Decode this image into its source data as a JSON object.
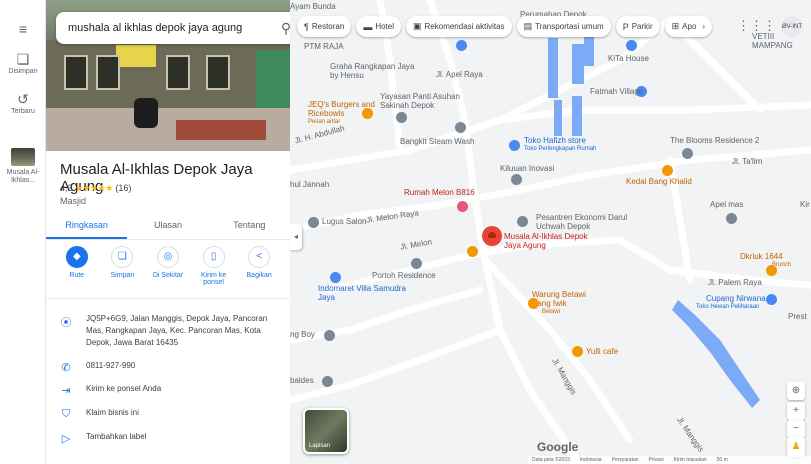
{
  "rail": {
    "menu_icon": "menu-icon",
    "saved_label": "Disimpan",
    "recent_label": "Terbaru",
    "recent_place_label": "Musala Al-Ikhlas..."
  },
  "search": {
    "query": "mushala al ikhlas depok jaya agung"
  },
  "place": {
    "title": "Musala Al-Ikhlas Depok Jaya Agung",
    "rating": "4,3",
    "stars": "★★★★★",
    "reviews": "(16)",
    "category": "Masjid"
  },
  "tabs": [
    {
      "label": "Ringkasan"
    },
    {
      "label": "Ulasan"
    },
    {
      "label": "Tentang"
    }
  ],
  "actions": [
    {
      "label": "Rute",
      "glyph": "◆"
    },
    {
      "label": "Simpan",
      "glyph": "❏"
    },
    {
      "label": "Di Sekitar",
      "glyph": "◎"
    },
    {
      "label": "Kirim ke ponsel",
      "glyph": "▯"
    },
    {
      "label": "Bagikan",
      "glyph": "<"
    }
  ],
  "info": {
    "address": "JQ5P+6G9, Jalan Manggis, Depok Jaya, Pancoran Mas, Rangkapan Jaya, Kec. Pancoran Mas, Kota Depok, Jawa Barat 16435",
    "phone": "0811-927-990",
    "send": "Kirim ke ponsel Anda",
    "claim": "Klaim bisnis ini",
    "label": "Tambahkan label"
  },
  "chips": [
    {
      "glyph": "¶",
      "label": "Restoran"
    },
    {
      "glyph": "▬",
      "label": "Hotel"
    },
    {
      "glyph": "▣",
      "label": "Rekomendasi aktivitas"
    },
    {
      "glyph": "▤",
      "label": "Transportasi umum"
    },
    {
      "glyph": "P",
      "label": "Parkir"
    },
    {
      "glyph": "⊞",
      "label": "Apo"
    }
  ],
  "map": {
    "account": "ØV-INT",
    "layers_label": "Lapisan",
    "google": "Google",
    "footer": [
      "Data peta ©2023",
      "Indonesia",
      "Persyaratan",
      "Privasi",
      "Kirim masukan",
      "50 m"
    ],
    "labels": {
      "ayam_bunda": "Ayam Bunda",
      "perumahan_depok": "Perumahan Depok",
      "ptm_raja": "PTM RAJA",
      "kita_house": "KiTa House",
      "vetamampang": "VETIII MAMPANG",
      "graha": "Graha Rangkapan Jaya by Hensu",
      "apel_raya": "Jl. Apel Raya",
      "fatmah": "Fatmah Village",
      "jeqs": "JEQ's Burgers and Ricebowls",
      "jeqs_sub": "Pesan antar",
      "yayasan": "Yayasan Panti Asuhan Sakinah Depok",
      "aldulah": "Jl. H. Abdullah",
      "bangkit": "Bangkit Steam Wash",
      "hafizh": "Toko Hafizh store",
      "hafizh_sub": "Toko Perlengkapan Rumah",
      "blooms": "The Blooms Residence 2",
      "talim": "Jl. Ta'lim",
      "jannah": "hul Jannah",
      "kiluuan": "Kiluuan Inovasi",
      "kedai": "Kedai Bang Khalid",
      "melon": "Rumah Melon B816",
      "apel_mas": "Apel mas",
      "lugus": "Lugus Salon",
      "melon_raya": "Jl. Melon Raya",
      "pesantren": "Pesantren Ekonomi Darul Uchwah Depok",
      "musala": "Musala Al-Ikhlas Depok Jaya Agung",
      "jl_melon": "Jl. Melon",
      "portoh": "Portoh Residence",
      "dkriuk": "Dkriuk 1644",
      "dkriuk_sub": "Brunch",
      "palem": "Jl. Palem Raya",
      "indomaret": "Indomaret Villa Samudra Jaya",
      "warung": "Warung Betawi Bang Iwik",
      "warung_sub": "Betawi",
      "cupang": "Cupang Nirwana",
      "cupang_sub": "Toko Hewan Peliharaan",
      "prest": "Prest",
      "boy": "ng Boy",
      "yulli": "Yulli cafe",
      "manggis": "Jl. Manggis",
      "baldes": "baldes",
      "manggis2": "Jl. Manggis",
      "kir": "Kir"
    }
  }
}
